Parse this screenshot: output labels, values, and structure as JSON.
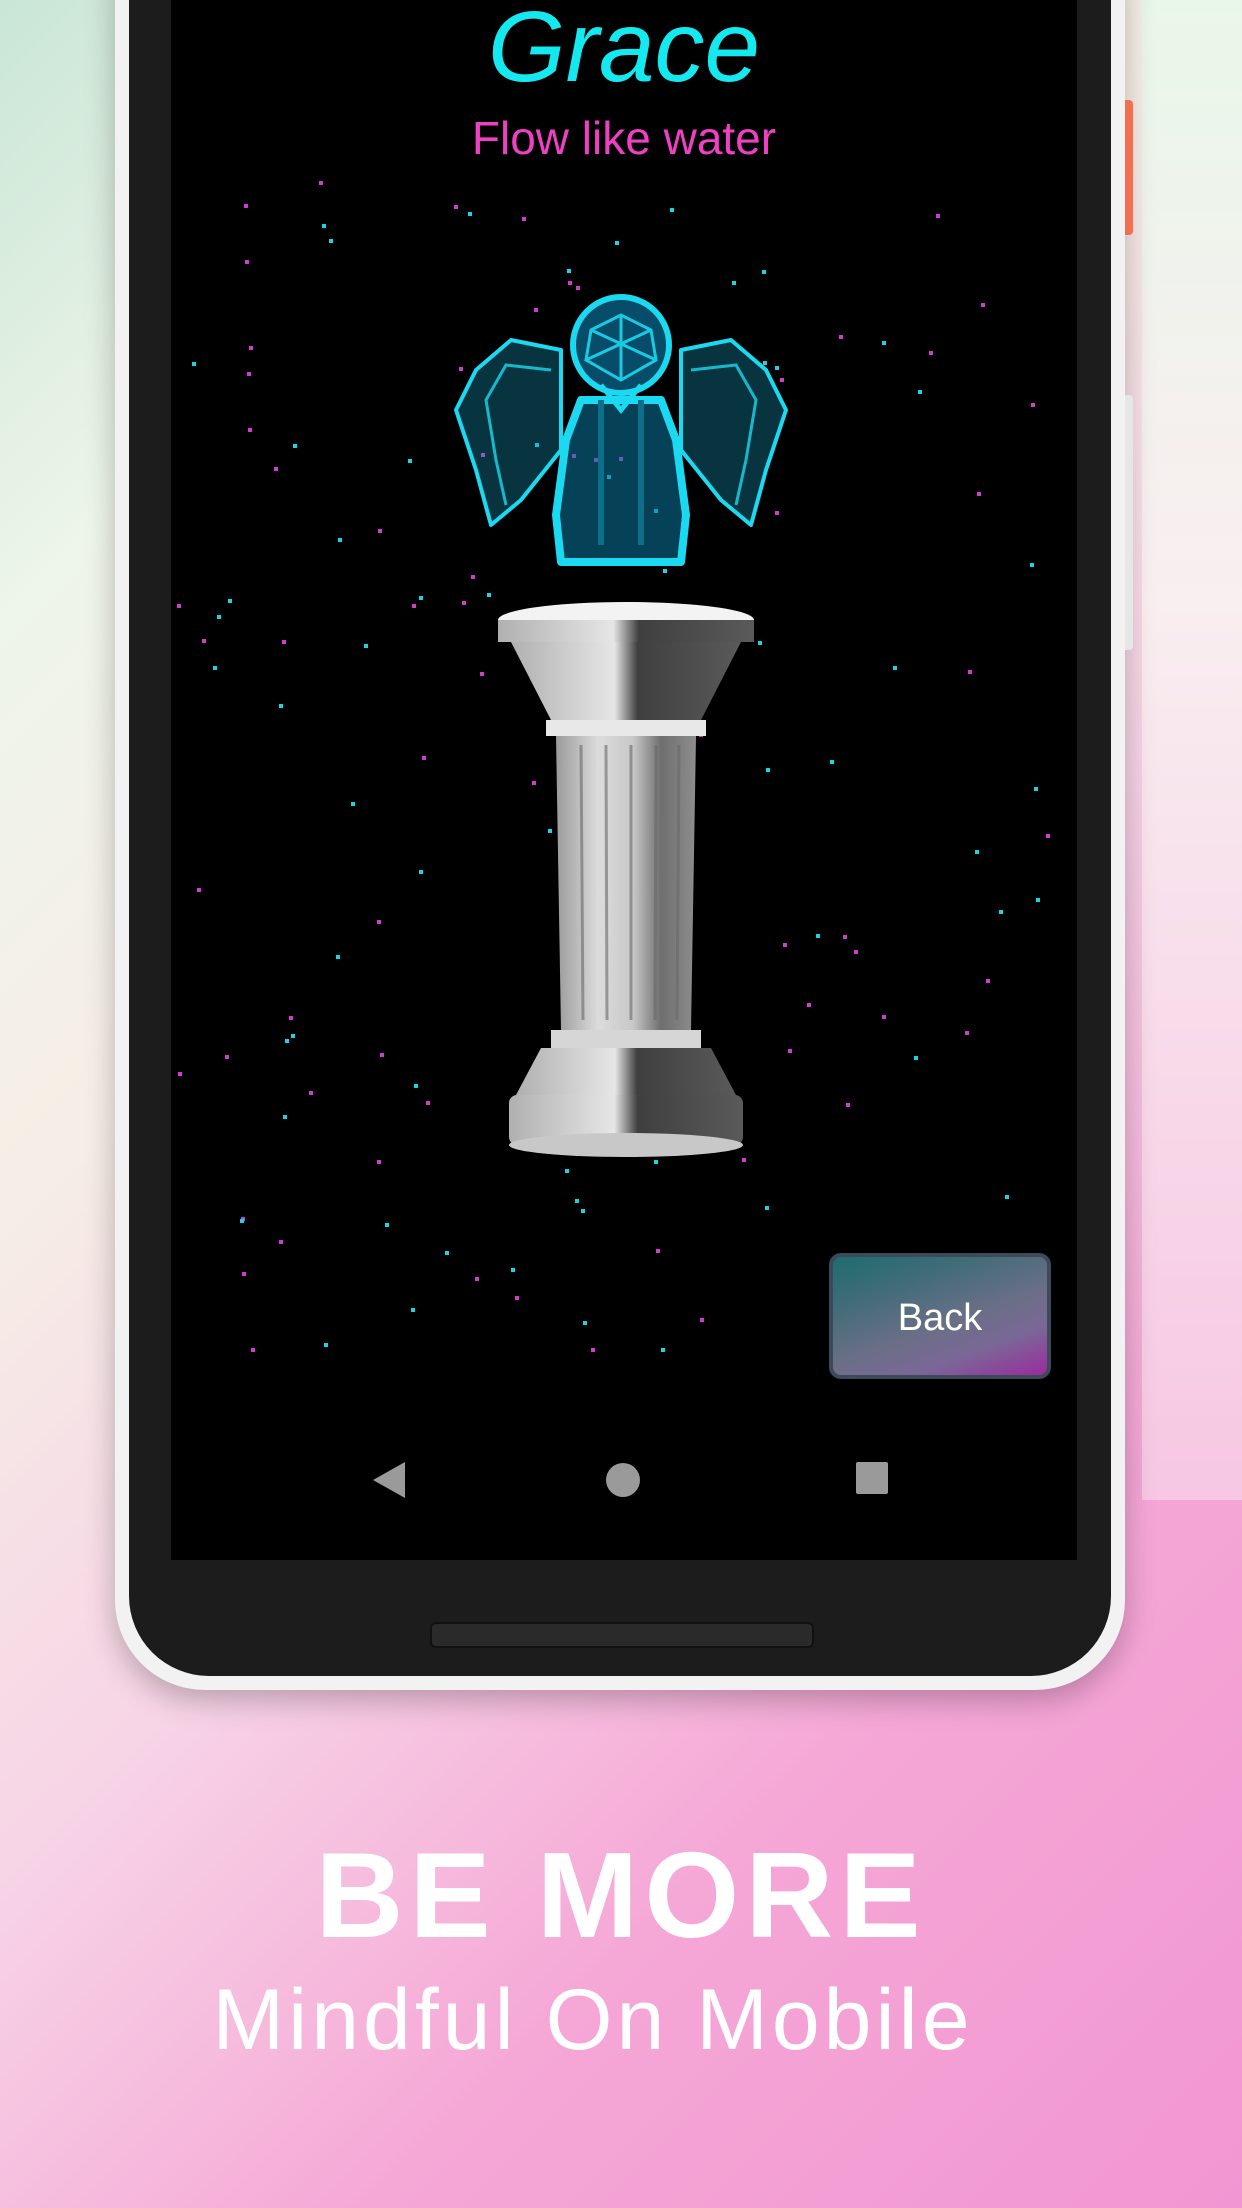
{
  "screen": {
    "title": "Grace",
    "subtitle": "Flow like water",
    "back_button_label": "Back"
  },
  "navigation_bar": {
    "icons": [
      "back-triangle",
      "home-circle",
      "recents-square"
    ]
  },
  "promo": {
    "headline": "BE MORE",
    "tagline": "Mindful On Mobile"
  },
  "colors": {
    "title": "#15e9f0",
    "subtitle": "#ef3fc4",
    "screen_background": "#000000",
    "angel": "#1ad9f0",
    "pillar": "#e0e0e0",
    "promo_background": "#f196d2"
  }
}
